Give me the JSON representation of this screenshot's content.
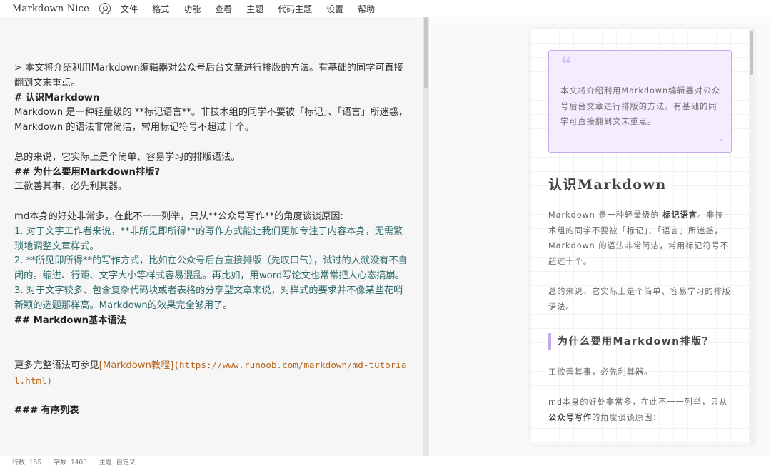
{
  "app": {
    "title": "Markdown Nice"
  },
  "menu": {
    "items": [
      "文件",
      "格式",
      "功能",
      "查看",
      "主题",
      "代码主题",
      "设置",
      "帮助"
    ]
  },
  "editor": {
    "lines": [
      "> 本文将介绍利用Markdown编辑器对公众号后台文章进行排版的方法。有基础的同学可直接翻到文末重点。",
      "# 认识Markdown",
      "Markdown 是一种轻量级的 **标记语言**。非技术组的同学不要被「标记」、「语言」所迷惑，Markdown 的语法非常简洁，常用标记符号不超过十个。",
      "",
      "总的来说，它实际上是个简单、容易学习的排版语法。",
      "## 为什么要用Markdown排版?",
      "工欲善其事，必先利其器。",
      "",
      "md本身的好处非常多，在此不一一列举，只从**公众号写作**的角度谈谈原因:",
      "1. 对于文字工作者来说，**非所见即所得**的写作方式能让我们更加专注于内容本身，无需繁琐地调整文章样式。",
      "2. **所见即所得**的写作方式，比如在公众号后台直接排版（先叹口气），试过的人就没有不自闭的。缩进、行距、文字大小等样式容易混乱。再比如，用word写论文也常常把人心态搞崩。",
      "3. 对于文字较多、包含复杂代码块或者表格的分享型文章来说，对样式的要求并不像某些花哨新颖的选题那样高。Markdown的效果完全够用了。",
      "## Markdown基本语法",
      "",
      "",
      "更多完整语法可参见[Markdown教程](https://www.runoob.com/markdown/md-tutorial.html)",
      "",
      "### 有序列表"
    ],
    "link_text": "[Markdown教程]",
    "link_url": "(https://www.runoob.com/markdown/md-tutorial.html)",
    "link_prefix": "更多完整语法可参见"
  },
  "preview": {
    "quote_open": "❝",
    "quote_text": "本文将介绍利用Markdown编辑器对公众号后台文章进行排版的方法。有基础的同学可直接翻到文末重点。",
    "quote_close": "❞",
    "h1": "认识Markdown",
    "p1_before": "Markdown 是一种轻量级的 ",
    "p1_strong": "标记语言",
    "p1_after": "。非技术组的同学不要被「标记」、「语言」所迷惑，Markdown 的语法非常简洁，常用标记符号不超过十个。",
    "p2": "总的来说，它实际上是个简单、容易学习的排版语法。",
    "h2": "为什么要用Markdown排版？",
    "p3": "工欲善其事，必先利其器。",
    "p4_before": "md本身的好处非常多，在此不一一列举，只从",
    "p4_strong": "公众号写作",
    "p4_after": "的角度谈谈原因："
  },
  "status": {
    "lines": "行数: 155",
    "chars": "字数: 1403",
    "theme": "主题: 自定义"
  },
  "colors": {
    "accent": "#c7a9ee",
    "quote_bg": "#f4ecff",
    "editor_bg": "#f6f6f6",
    "list_text": "#2e6a6a",
    "link": "#b5661c"
  }
}
